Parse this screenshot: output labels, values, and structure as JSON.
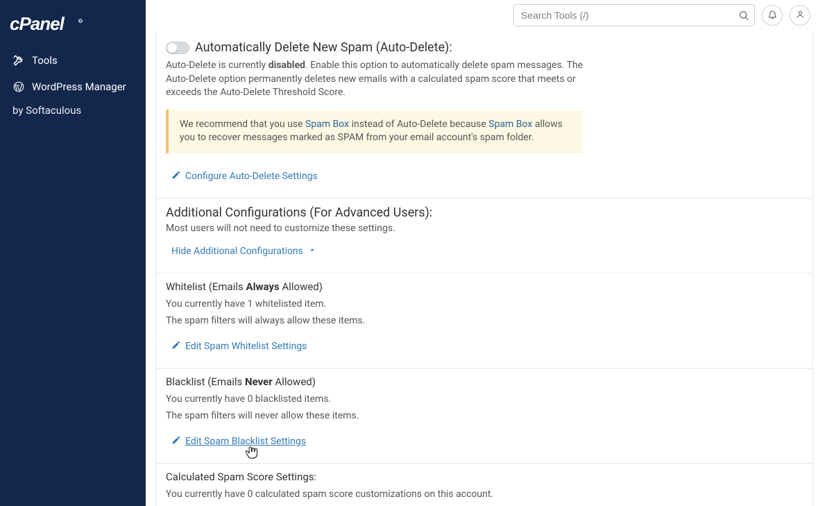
{
  "header": {
    "search_placeholder": "Search Tools (/)"
  },
  "sidebar": {
    "items": [
      {
        "label": "Tools"
      },
      {
        "label": "WordPress Manager"
      }
    ],
    "subline": "by Softaculous"
  },
  "auto_delete": {
    "title": "Automatically Delete New Spam (Auto-Delete):",
    "desc_prefix": "Auto-Delete is currently ",
    "desc_bold": "disabled",
    "desc_suffix": ". Enable this option to automatically delete spam messages. The Auto-Delete option permanently deletes new emails with a calculated spam score that meets or exceeds the Auto-Delete Threshold Score.",
    "configure_label": "Configure Auto-Delete Settings"
  },
  "alert": {
    "t1": "We recommend that you use ",
    "link1": "Spam Box",
    "t2": " instead of Auto-Delete because ",
    "link2": "Spam Box",
    "t3": " allows you to recover messages marked as SPAM from your email account's spam folder."
  },
  "additional": {
    "title": "Additional Configurations (For Advanced Users):",
    "desc": "Most users will not need to customize these settings.",
    "toggle_label": "Hide Additional Configurations "
  },
  "whitelist": {
    "title_pre": "Whitelist (Emails ",
    "title_em": "Always",
    "title_post": " Allowed)",
    "count_line": "You currently have 1 whitelisted item.",
    "desc": "The spam filters will always allow these items.",
    "edit_label": "Edit Spam Whitelist Settings"
  },
  "blacklist": {
    "title_pre": "Blacklist (Emails ",
    "title_em": "Never",
    "title_post": " Allowed)",
    "count_line": "You currently have 0 blacklisted items.",
    "desc": "The spam filters will never allow these items.",
    "edit_label": " Edit Spam Blacklist Settings"
  },
  "score": {
    "title": "Calculated Spam Score Settings:",
    "desc": "You currently have 0 calculated spam score customizations on this account."
  }
}
